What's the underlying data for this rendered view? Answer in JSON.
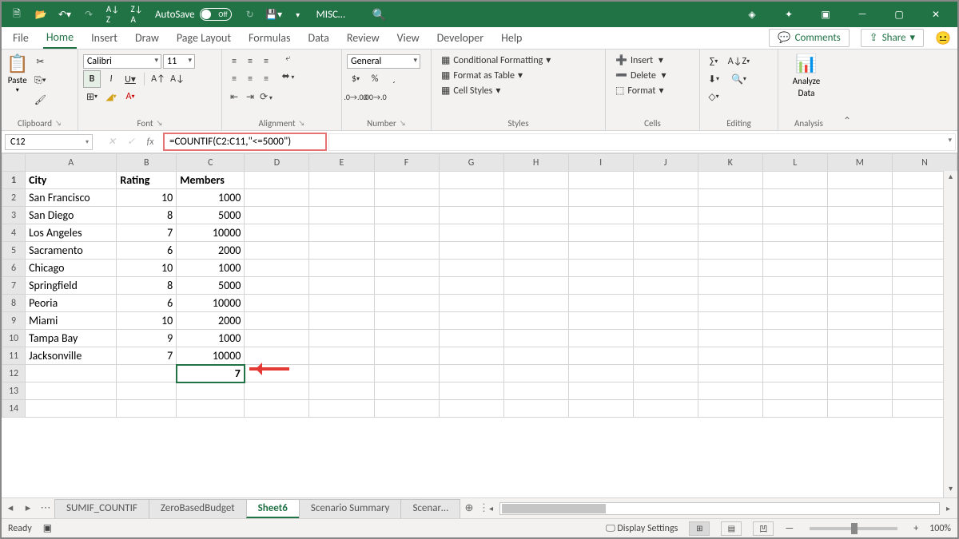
{
  "titlebar": {
    "autosave_label": "AutoSave",
    "autosave_state": "Off",
    "filename": "MISC…"
  },
  "tabs": {
    "file": "File",
    "home": "Home",
    "insert": "Insert",
    "draw": "Draw",
    "page_layout": "Page Layout",
    "formulas": "Formulas",
    "data": "Data",
    "review": "Review",
    "view": "View",
    "developer": "Developer",
    "help": "Help",
    "comments": "Comments",
    "share": "Share"
  },
  "ribbon": {
    "clipboard": {
      "paste": "Paste",
      "label": "Clipboard"
    },
    "font": {
      "name": "Calibri",
      "size": "11",
      "label": "Font"
    },
    "alignment": {
      "wrap": "ab",
      "label": "Alignment"
    },
    "number": {
      "format": "General",
      "label": "Number"
    },
    "styles": {
      "cf": "Conditional Formatting",
      "table": "Format as Table",
      "cs": "Cell Styles",
      "label": "Styles"
    },
    "cells": {
      "insert": "Insert",
      "delete": "Delete",
      "format": "Format",
      "label": "Cells"
    },
    "editing": {
      "label": "Editing"
    },
    "analysis": {
      "analyze": "Analyze",
      "data": "Data",
      "label": "Analysis"
    }
  },
  "formula_bar": {
    "cellref": "C12",
    "formula": "=COUNTIF(C2:C11,\"<=5000\")"
  },
  "grid": {
    "columns": [
      "A",
      "B",
      "C",
      "D",
      "E",
      "F",
      "G",
      "H",
      "I",
      "J",
      "K",
      "L",
      "M",
      "N"
    ],
    "headers": [
      "City",
      "Rating",
      "Members"
    ],
    "rows": [
      {
        "n": 1
      },
      {
        "n": 2,
        "city": "San Francisco",
        "rating": 10,
        "members": 1000
      },
      {
        "n": 3,
        "city": "San Diego",
        "rating": 8,
        "members": 5000
      },
      {
        "n": 4,
        "city": "Los Angeles",
        "rating": 7,
        "members": 10000
      },
      {
        "n": 5,
        "city": "Sacramento",
        "rating": 6,
        "members": 2000
      },
      {
        "n": 6,
        "city": "Chicago",
        "rating": 10,
        "members": 1000
      },
      {
        "n": 7,
        "city": "Springfield",
        "rating": 8,
        "members": 5000
      },
      {
        "n": 8,
        "city": "Peoria",
        "rating": 6,
        "members": 10000
      },
      {
        "n": 9,
        "city": "Miami",
        "rating": 10,
        "members": 2000
      },
      {
        "n": 10,
        "city": "Tampa Bay",
        "rating": 9,
        "members": 1000
      },
      {
        "n": 11,
        "city": "Jacksonville",
        "rating": 7,
        "members": 10000
      }
    ],
    "result_cell": {
      "n": 12,
      "value": "7"
    }
  },
  "sheets": {
    "tabs": [
      "SUMIF_COUNTIF",
      "ZeroBasedBudget",
      "Sheet6",
      "Scenario Summary",
      "Scenar…"
    ],
    "active": 2
  },
  "status": {
    "ready": "Ready",
    "display": "Display Settings",
    "zoom": "100%"
  }
}
